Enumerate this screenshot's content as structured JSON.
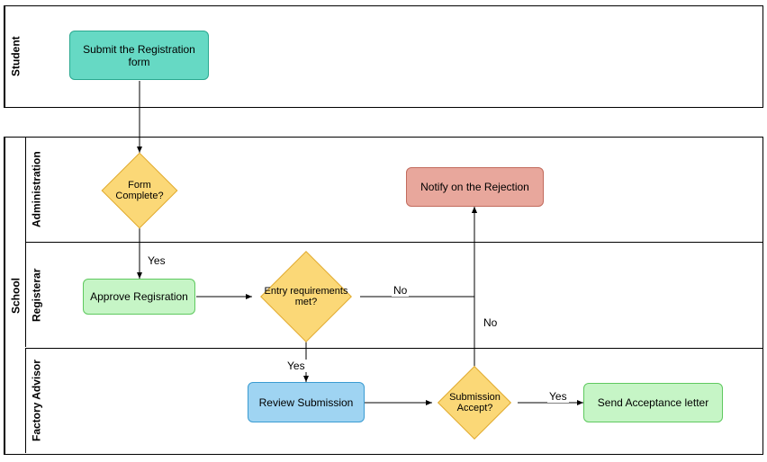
{
  "lanes": {
    "student": "Student",
    "school": "School",
    "administration": "Administration",
    "registerar": "Registerar",
    "factory_advisor": "Factory Advisor"
  },
  "nodes": {
    "submit": "Submit the Registration form",
    "form_complete": "Form Complete?",
    "approve": "Approve Regisration",
    "entry_req": "Entry requirements met?",
    "review": "Review Submission",
    "sub_accept": "Submission Accept?",
    "send_accept": "Send Acceptance letter",
    "notify_reject": "Notify on the Rejection"
  },
  "labels": {
    "yes1": "Yes",
    "no1": "No",
    "yes2": "Yes",
    "no2": "No",
    "yes3": "Yes"
  },
  "chart_data": {
    "type": "diagram",
    "diagram_type": "swimlane-flowchart",
    "lanes": [
      {
        "id": "student",
        "label": "Student"
      },
      {
        "id": "school",
        "label": "School",
        "sublanes": [
          {
            "id": "administration",
            "label": "Administration"
          },
          {
            "id": "registerar",
            "label": "Registerar"
          },
          {
            "id": "factory_advisor",
            "label": "Factory Advisor"
          }
        ]
      }
    ],
    "nodes": [
      {
        "id": "submit",
        "type": "process",
        "lane": "student",
        "label": "Submit the Registration form"
      },
      {
        "id": "form_complete",
        "type": "decision",
        "lane": "administration",
        "label": "Form Complete?"
      },
      {
        "id": "approve",
        "type": "process",
        "lane": "registerar",
        "label": "Approve Regisration"
      },
      {
        "id": "entry_req",
        "type": "decision",
        "lane": "registerar",
        "label": "Entry requirements met?"
      },
      {
        "id": "notify_reject",
        "type": "process",
        "lane": "administration",
        "label": "Notify on the Rejection"
      },
      {
        "id": "review",
        "type": "process",
        "lane": "factory_advisor",
        "label": "Review Submission"
      },
      {
        "id": "sub_accept",
        "type": "decision",
        "lane": "factory_advisor",
        "label": "Submission Accept?"
      },
      {
        "id": "send_accept",
        "type": "process",
        "lane": "factory_advisor",
        "label": "Send Acceptance letter"
      }
    ],
    "edges": [
      {
        "from": "submit",
        "to": "form_complete"
      },
      {
        "from": "form_complete",
        "to": "approve",
        "label": "Yes"
      },
      {
        "from": "approve",
        "to": "entry_req"
      },
      {
        "from": "entry_req",
        "to": "notify_reject",
        "label": "No"
      },
      {
        "from": "entry_req",
        "to": "review",
        "label": "Yes"
      },
      {
        "from": "review",
        "to": "sub_accept"
      },
      {
        "from": "sub_accept",
        "to": "notify_reject",
        "label": "No"
      },
      {
        "from": "sub_accept",
        "to": "send_accept",
        "label": "Yes"
      }
    ]
  }
}
